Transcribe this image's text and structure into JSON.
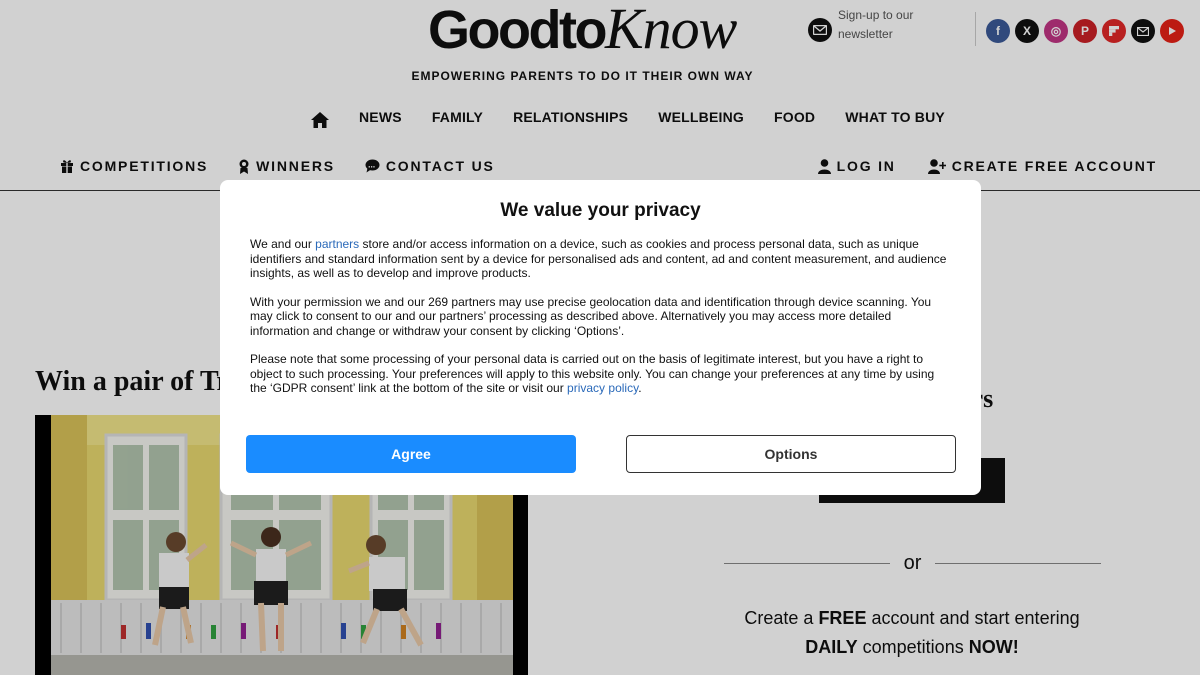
{
  "header": {
    "logo_part1": "Goodto",
    "logo_part2": "Know",
    "newsletter_text": "Sign-up to our newsletter",
    "tagline": "EMPOWERING PARENTS TO DO IT THEIR OWN WAY",
    "socials": [
      {
        "icon": "facebook-icon",
        "glyph": "f",
        "color": "#3b5998"
      },
      {
        "icon": "x-icon",
        "glyph": "X",
        "color": "#111111"
      },
      {
        "icon": "instagram-icon",
        "glyph": "◎",
        "color": "#c13584"
      },
      {
        "icon": "pinterest-icon",
        "glyph": "P",
        "color": "#cb2027"
      },
      {
        "icon": "flipboard-icon",
        "glyph": "▰",
        "color": "#e12828"
      },
      {
        "icon": "email-icon",
        "glyph": "✉",
        "color": "#111111"
      },
      {
        "icon": "youtube-icon",
        "glyph": "▶",
        "color": "#e62117"
      }
    ]
  },
  "nav": {
    "items": [
      "NEWS",
      "FAMILY",
      "RELATIONSHIPS",
      "WELLBEING",
      "FOOD",
      "WHAT TO BUY"
    ]
  },
  "subnav": {
    "competitions": "COMPETITIONS",
    "winners": "WINNERS",
    "contact": "CONTACT US",
    "login": "LOG IN",
    "create_account": "CREATE FREE ACCOUNT"
  },
  "content": {
    "article_title": "Win a pair of Trespass school shoes",
    "side_heading": "ers",
    "or_text": "or",
    "cta_part1": "Create a ",
    "cta_bold1": "FREE",
    "cta_part2": " account and start entering",
    "cta_bold2": "DAILY",
    "cta_part3": " competitions ",
    "cta_bold3": "NOW!"
  },
  "modal": {
    "title": "We value your privacy",
    "p1_before": "We and our ",
    "p1_link": "partners",
    "p1_after": " store and/or access information on a device, such as cookies and process personal data, such as unique identifiers and standard information sent by a device for personalised ads and content, ad and content measurement, and audience insights, as well as to develop and improve products.",
    "p2": "With your permission we and our 269 partners may use precise geolocation data and identification through device scanning. You may click to consent to our and our partners’ processing as described above. Alternatively you may access more detailed information and change or withdraw your consent by clicking ‘Options’.",
    "p3_before": "Please note that some processing of your personal data is carried out on the basis of legitimate interest, but you have a right to object to such processing. Your preferences will apply to this website only. You can change your preferences at any time by using the ‘GDPR consent’ link at the bottom of the site or visit our ",
    "p3_link": "privacy policy",
    "p3_after": ".",
    "agree_label": "Agree",
    "options_label": "Options"
  },
  "colors": {
    "agree_button": "#1a8cff",
    "link": "#2a69b9"
  }
}
